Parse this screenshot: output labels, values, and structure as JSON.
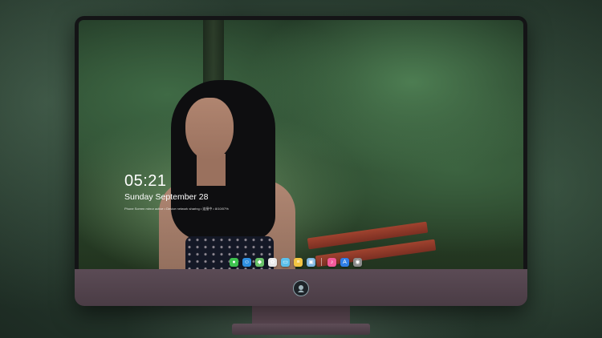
{
  "lockscreen": {
    "time": "05:21",
    "date": "Sunday September  28",
    "notice": "Phone Screen mirror active • Device network sharing • 连接中 • 8/10/07%"
  },
  "dock": {
    "icons": [
      {
        "name": "messages-icon",
        "color": "#3ec24f",
        "glyph": "●"
      },
      {
        "name": "finder-icon",
        "color": "#2f8fe0",
        "glyph": "☺"
      },
      {
        "name": "maps-icon",
        "color": "#6ac36a",
        "glyph": "◆"
      },
      {
        "name": "photos-icon",
        "color": "#e8e8e8",
        "glyph": "✿"
      },
      {
        "name": "folder-icon",
        "color": "#5bc0eb",
        "glyph": "▭"
      },
      {
        "name": "notes-icon",
        "color": "#f4c542",
        "glyph": "≡"
      },
      {
        "name": "preview-icon",
        "color": "#7fb6e0",
        "glyph": "▣"
      },
      {
        "name": "music-icon",
        "color": "#f25a9a",
        "glyph": "♪"
      },
      {
        "name": "app-store-icon",
        "color": "#2f7fe6",
        "glyph": "A"
      },
      {
        "name": "camera-icon",
        "color": "#8c8c8c",
        "glyph": "◉"
      }
    ]
  },
  "colors": {
    "bezel": "#141416",
    "chin": "#5b4b55"
  }
}
